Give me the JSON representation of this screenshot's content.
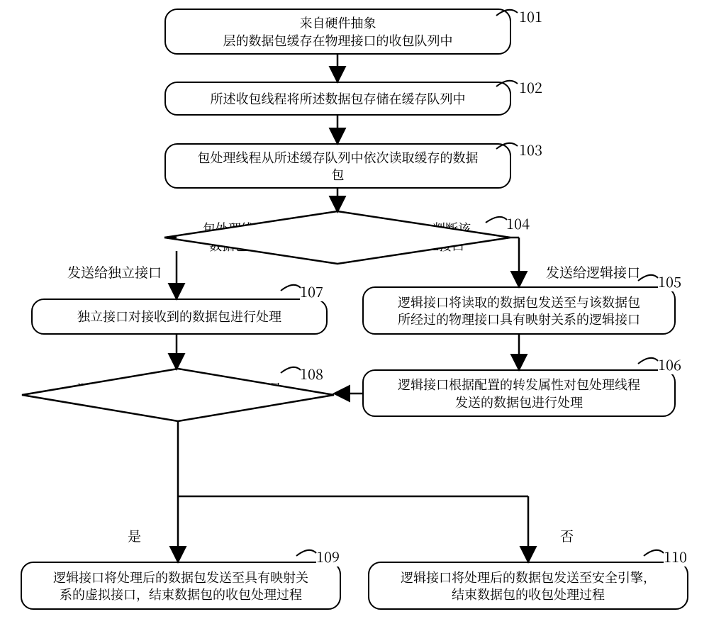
{
  "chart_data": {
    "type": "flowchart",
    "nodes": [
      {
        "id": "101",
        "shape": "box",
        "text": "来自硬件抽象\n层的数据包缓存在物理接口的收包队列中"
      },
      {
        "id": "102",
        "shape": "box",
        "text": "所述收包线程将所述数据包存储在缓存队列中"
      },
      {
        "id": "103",
        "shape": "box",
        "text": "包处理线程从所述缓存队列中依次读取缓存的数据\n包"
      },
      {
        "id": "104",
        "shape": "diamond",
        "text": "包处理线程对读取出的数据包进行识别，判断该\n数据包是发送至逻辑接口还是发送至独立接口"
      },
      {
        "id": "105",
        "shape": "box",
        "text": "逻辑接口将读取的数据包发送至与该数据包\n所经过的物理接口具有映射关系的逻辑接口"
      },
      {
        "id": "106",
        "shape": "box",
        "text": "逻辑接口根据配置的转发属性对包处理线程\n发送的数据包进行处理"
      },
      {
        "id": "107",
        "shape": "box",
        "text": "独立接口对接收到的数据包进行处理"
      },
      {
        "id": "108",
        "shape": "diamond",
        "text": "逻辑接口判断处理后的数据包是否是\n本地数据"
      },
      {
        "id": "109",
        "shape": "box",
        "text": "逻辑接口将处理后的数据包发送至具有映射关\n系的虚拟接口，结束数据包的收包处理过程"
      },
      {
        "id": "110",
        "shape": "box",
        "text": "逻辑接口将处理后的数据包发送至安全引擎，\n结束数据包的收包处理过程"
      }
    ],
    "edges": [
      {
        "from": "101",
        "to": "102"
      },
      {
        "from": "102",
        "to": "103"
      },
      {
        "from": "103",
        "to": "104"
      },
      {
        "from": "104",
        "to": "107",
        "label": "发送给独立接口"
      },
      {
        "from": "104",
        "to": "105",
        "label": "发送给逻辑接口"
      },
      {
        "from": "105",
        "to": "106"
      },
      {
        "from": "107",
        "to": "108"
      },
      {
        "from": "106",
        "to": "108"
      },
      {
        "from": "108",
        "to": "109",
        "label": "是"
      },
      {
        "from": "108",
        "to": "110",
        "label": "否"
      }
    ]
  },
  "labels": {
    "n101": "101",
    "n102": "102",
    "n103": "103",
    "n104": "104",
    "n105": "105",
    "n106": "106",
    "n107": "107",
    "n108": "108",
    "n109": "109",
    "n110": "110"
  },
  "boxes": {
    "b101": "来自硬件抽象\n层的数据包缓存在物理接口的收包队列中",
    "b102": "所述收包线程将所述数据包存储在缓存队列中",
    "b103": "包处理线程从所述缓存队列中依次读取缓存的数据\n包",
    "b104": "包处理线程对读取出的数据包进行识别，判断该\n数据包是发送至逻辑接口还是发送至独立接口",
    "b105": "逻辑接口将读取的数据包发送至与该数据包\n所经过的物理接口具有映射关系的逻辑接口",
    "b106": "逻辑接口根据配置的转发属性对包处理线程\n发送的数据包进行处理",
    "b107": "独立接口对接收到的数据包进行处理",
    "b108": "逻辑接口判断处理后的数据包是否是\n本地数据",
    "b109": "逻辑接口将处理后的数据包发送至具有映射关\n系的虚拟接口，结束数据包的收包处理过程",
    "b110": "逻辑接口将处理后的数据包发送至安全引擎，\n结束数据包的收包处理过程"
  },
  "edge_labels": {
    "to107": "发送给独立接口",
    "to105": "发送给逻辑接口",
    "yes": "是",
    "no": "否"
  }
}
